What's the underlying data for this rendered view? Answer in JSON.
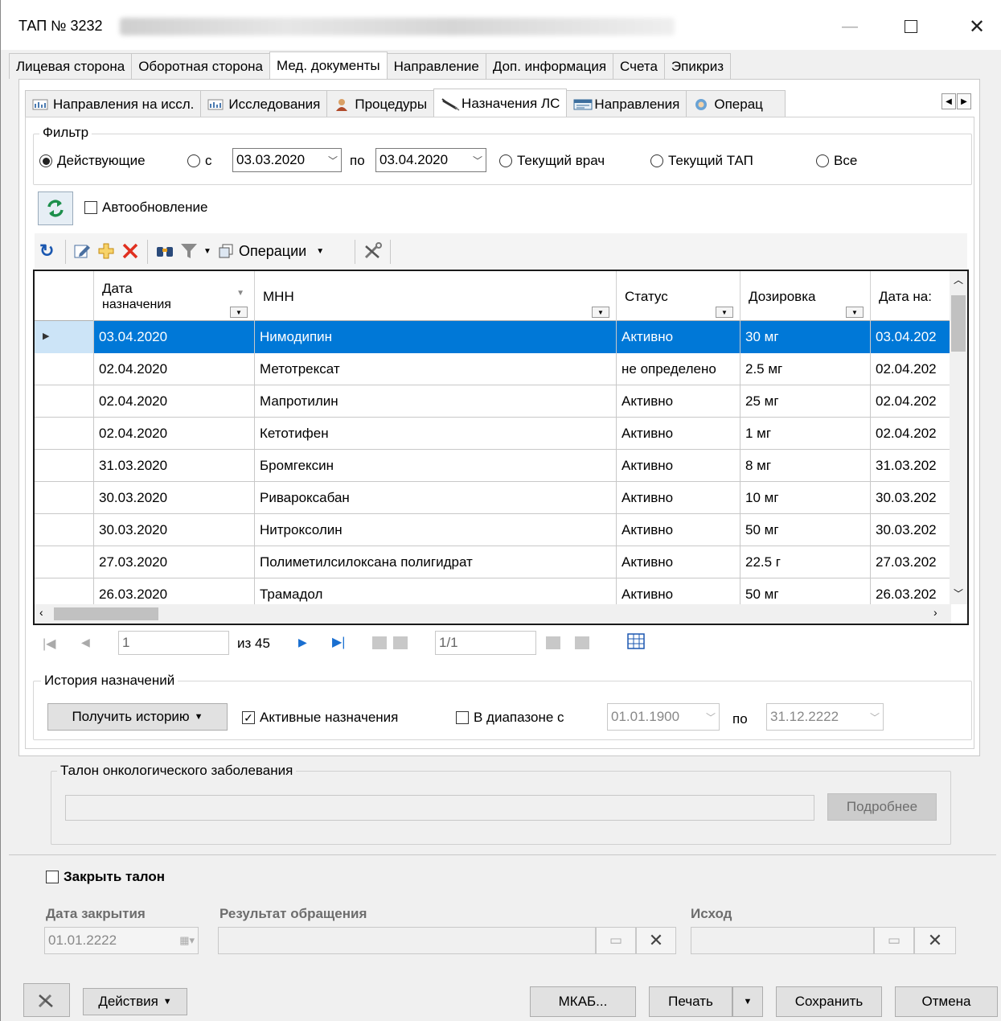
{
  "window": {
    "title": "ТАП № 3232"
  },
  "main_tabs": [
    "Лицевая сторона",
    "Оборотная сторона",
    "Мед. документы",
    "Направление",
    "Доп. информация",
    "Счета",
    "Эпикриз"
  ],
  "sub_tabs": [
    "Направления на иссл.",
    "Исследования",
    "Процедуры",
    "Назначения ЛС",
    "Направления",
    "Операц"
  ],
  "filter": {
    "label": "Фильтр",
    "r_active": "Действующие",
    "r_from": "с",
    "date_from": "03.03.2020",
    "to": "по",
    "date_to": "03.04.2020",
    "r_doctor": "Текущий врач",
    "r_tap": "Текущий ТАП",
    "r_all": "Все"
  },
  "autoupdate": "Автообновление",
  "toolbar": {
    "operations": "Операции"
  },
  "grid": {
    "headers": [
      "Дата назначения",
      "МНН",
      "Статус",
      "Дозировка",
      "Дата на:"
    ],
    "header_date_line1": "Дата",
    "header_date_line2": "назначения",
    "rows": [
      [
        "03.04.2020",
        "Нимодипин",
        "Активно",
        "30 мг",
        "03.04.202"
      ],
      [
        "02.04.2020",
        "Метотрексат",
        "не определено",
        "2.5 мг",
        "02.04.202"
      ],
      [
        "02.04.2020",
        "Мапротилин",
        "Активно",
        "25 мг",
        "02.04.202"
      ],
      [
        "02.04.2020",
        "Кетотифен",
        "Активно",
        "1 мг",
        "02.04.202"
      ],
      [
        "31.03.2020",
        "Бромгексин",
        "Активно",
        "8 мг",
        "31.03.202"
      ],
      [
        "30.03.2020",
        "Ривароксабан",
        "Активно",
        "10 мг",
        "30.03.202"
      ],
      [
        "30.03.2020",
        "Нитроксолин",
        "Активно",
        "50 мг",
        "30.03.202"
      ],
      [
        "27.03.2020",
        "Полиметилсилоксана полигидрат",
        "Активно",
        "22.5 г",
        "27.03.202"
      ],
      [
        "26.03.2020",
        "Трамадол",
        "Активно",
        "50 мг",
        "26.03.202"
      ]
    ]
  },
  "pager": {
    "page": "1",
    "of": "из 45",
    "rec": "1/1"
  },
  "history": {
    "label": "История назначений",
    "get_btn": "Получить историю",
    "active_chk": "Активные назначения",
    "range_chk": "В диапазоне с",
    "from": "01.01.1900",
    "to_label": "по",
    "to": "31.12.2222"
  },
  "onco": {
    "label": "Талон онкологического заболевания",
    "details_btn": "Подробнее"
  },
  "close": {
    "chk": "Закрыть талон",
    "date_label": "Дата закрытия",
    "date": "01.01.2222",
    "result_label": "Результат обращения",
    "outcome_label": "Исход"
  },
  "bottom": {
    "actions": "Действия",
    "mkab": "МКАБ...",
    "print": "Печать",
    "save": "Сохранить",
    "cancel": "Отмена"
  }
}
